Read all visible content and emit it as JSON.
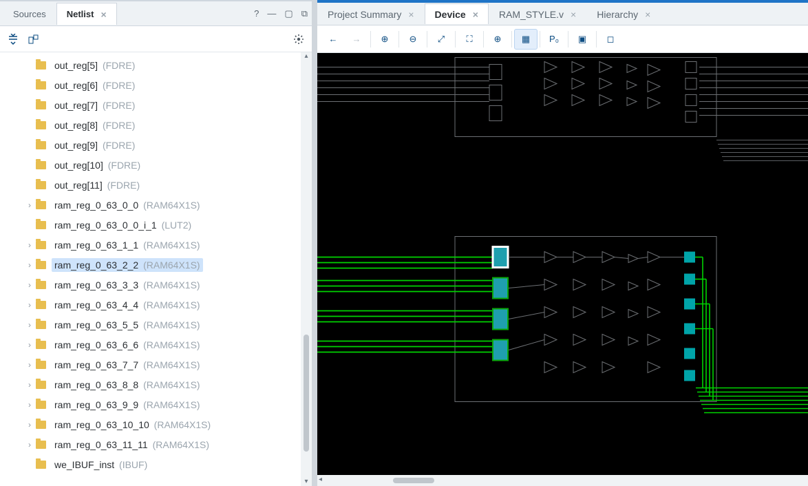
{
  "left": {
    "tabs": [
      {
        "label": "Sources",
        "active": false
      },
      {
        "label": "Netlist",
        "active": true
      }
    ],
    "selected_index": 10,
    "tree": [
      {
        "name": "out_reg[5]",
        "type": "(FDRE)",
        "expandable": false
      },
      {
        "name": "out_reg[6]",
        "type": "(FDRE)",
        "expandable": false
      },
      {
        "name": "out_reg[7]",
        "type": "(FDRE)",
        "expandable": false
      },
      {
        "name": "out_reg[8]",
        "type": "(FDRE)",
        "expandable": false
      },
      {
        "name": "out_reg[9]",
        "type": "(FDRE)",
        "expandable": false
      },
      {
        "name": "out_reg[10]",
        "type": "(FDRE)",
        "expandable": false
      },
      {
        "name": "out_reg[11]",
        "type": "(FDRE)",
        "expandable": false
      },
      {
        "name": "ram_reg_0_63_0_0",
        "type": "(RAM64X1S)",
        "expandable": true
      },
      {
        "name": "ram_reg_0_63_0_0_i_1",
        "type": "(LUT2)",
        "expandable": false
      },
      {
        "name": "ram_reg_0_63_1_1",
        "type": "(RAM64X1S)",
        "expandable": true
      },
      {
        "name": "ram_reg_0_63_2_2",
        "type": "(RAM64X1S)",
        "expandable": true
      },
      {
        "name": "ram_reg_0_63_3_3",
        "type": "(RAM64X1S)",
        "expandable": true
      },
      {
        "name": "ram_reg_0_63_4_4",
        "type": "(RAM64X1S)",
        "expandable": true
      },
      {
        "name": "ram_reg_0_63_5_5",
        "type": "(RAM64X1S)",
        "expandable": true
      },
      {
        "name": "ram_reg_0_63_6_6",
        "type": "(RAM64X1S)",
        "expandable": true
      },
      {
        "name": "ram_reg_0_63_7_7",
        "type": "(RAM64X1S)",
        "expandable": true
      },
      {
        "name": "ram_reg_0_63_8_8",
        "type": "(RAM64X1S)",
        "expandable": true
      },
      {
        "name": "ram_reg_0_63_9_9",
        "type": "(RAM64X1S)",
        "expandable": true
      },
      {
        "name": "ram_reg_0_63_10_10",
        "type": "(RAM64X1S)",
        "expandable": true
      },
      {
        "name": "ram_reg_0_63_11_11",
        "type": "(RAM64X1S)",
        "expandable": true
      },
      {
        "name": "we_IBUF_inst",
        "type": "(IBUF)",
        "expandable": false
      }
    ]
  },
  "right": {
    "tabs": [
      {
        "label": "Project Summary",
        "active": false,
        "closeable": true
      },
      {
        "label": "Device",
        "active": true,
        "closeable": true
      },
      {
        "label": "RAM_STYLE.v",
        "active": false,
        "closeable": true
      },
      {
        "label": "Hierarchy",
        "active": false,
        "closeable": true
      }
    ],
    "toolbar": [
      {
        "id": "back",
        "glyph": "←",
        "disabled": false
      },
      {
        "id": "forward",
        "glyph": "→",
        "disabled": true
      },
      {
        "sep": true
      },
      {
        "id": "zoom-in",
        "glyph": "⊕"
      },
      {
        "sep": true
      },
      {
        "id": "zoom-out",
        "glyph": "⊖"
      },
      {
        "sep": true
      },
      {
        "id": "zoom-fit",
        "glyph": "⤢"
      },
      {
        "sep": true
      },
      {
        "id": "zoom-area",
        "glyph": "⛶"
      },
      {
        "sep": true
      },
      {
        "id": "autofit",
        "glyph": "⊕"
      },
      {
        "sep": true
      },
      {
        "id": "routing",
        "glyph": "▦",
        "active": true
      },
      {
        "sep": true
      },
      {
        "id": "place",
        "glyph": "P₀"
      },
      {
        "sep": true
      },
      {
        "id": "show-io",
        "glyph": "▣"
      },
      {
        "sep": true
      },
      {
        "id": "show-sel",
        "glyph": "◻"
      }
    ]
  }
}
